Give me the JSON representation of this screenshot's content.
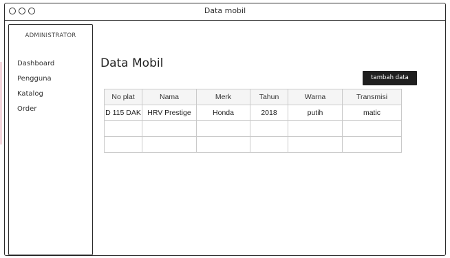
{
  "window": {
    "title": "Data mobil"
  },
  "sidebar": {
    "title": "ADMINISTRATOR",
    "items": [
      {
        "label": "Dashboard"
      },
      {
        "label": "Pengguna"
      },
      {
        "label": "Katalog"
      },
      {
        "label": "Order"
      }
    ]
  },
  "main": {
    "title": "Data Mobil",
    "add_button": "tambah data",
    "table": {
      "columns": [
        "No plat",
        "Nama",
        "Merk",
        "Tahun",
        "Warna",
        "Transmisi"
      ],
      "rows": [
        [
          "D 115 DAK",
          "HRV Prestige",
          "Honda",
          "2018",
          "putih",
          "matic"
        ],
        [
          "",
          "",
          "",
          "",
          "",
          ""
        ],
        [
          "",
          "",
          "",
          "",
          "",
          ""
        ]
      ]
    }
  }
}
